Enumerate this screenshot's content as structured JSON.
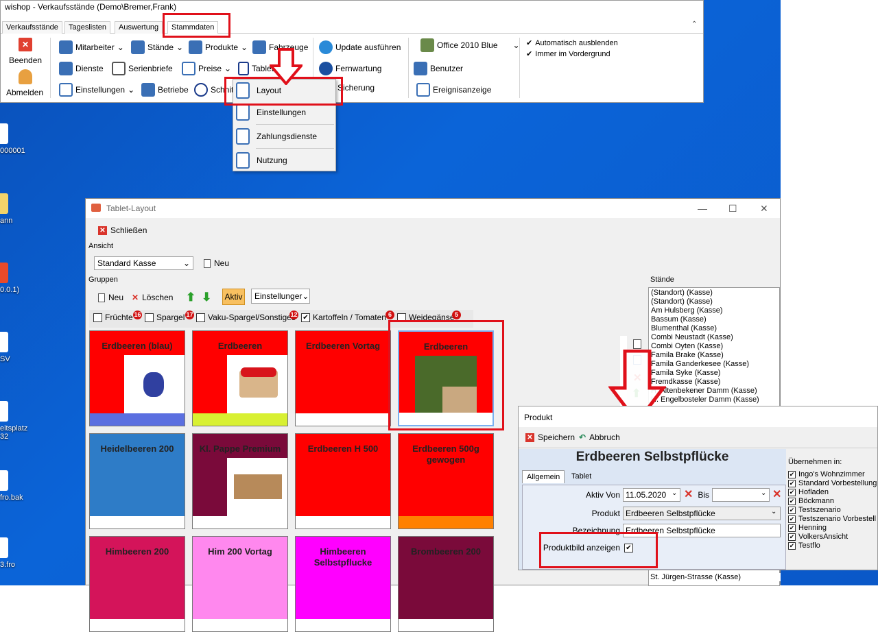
{
  "app": {
    "title": "wishop - Verkaufsstände (Demo\\Bremer,Frank)"
  },
  "tabs": [
    "Verkaufsstände",
    "Tageslisten",
    "Auswertung",
    "Stammdaten"
  ],
  "ribbon": {
    "beenden": "Beenden",
    "abmelden": "Abmelden",
    "mitarbeiter": "Mitarbeiter",
    "dienste": "Dienste",
    "einstellungen": "Einstellungen",
    "staende": "Stände",
    "serienbriefe": "Serienbriefe",
    "betriebe": "Betriebe",
    "produkte": "Produkte",
    "preise": "Preise",
    "schnitt": "Schnit",
    "fahrzeuge": "Fahrzeuge",
    "tablet": "Tablet",
    "update": "Update ausführen",
    "fernwartung": "Fernwartung",
    "sicherung": "Sicherung",
    "theme": "Office 2010 Blue",
    "benutzer": "Benutzer",
    "ereignisanzeige": "Ereignisanzeige",
    "auto_hide": "Automatisch ausblenden",
    "always_top": "Immer im Vordergrund"
  },
  "tablet_menu": [
    "Layout",
    "Einstellungen",
    "Zahlungsdienste",
    "Nutzung"
  ],
  "desktop_icons": [
    "000001",
    "ann",
    "0.0.1)",
    "SV",
    "eitsplatz",
    "32",
    "fro.bak",
    "3.fro"
  ],
  "tablet_layout": {
    "title": "Tablet-Layout",
    "close": "Schließen",
    "ansicht_label": "Ansicht",
    "ansicht_value": "Standard Kasse",
    "neu": "Neu",
    "gruppen_label": "Gruppen",
    "grp_neu": "Neu",
    "grp_loeschen": "Löschen",
    "aktiv": "Aktiv",
    "einstellungen": "Einstellunger",
    "staende_label": "Stände",
    "groups": [
      {
        "name": "Früchte",
        "count": "16",
        "checked": false
      },
      {
        "name": "Spargel",
        "count": "17",
        "checked": false
      },
      {
        "name": "Vaku-Spargel/Sonstiges",
        "count": "12",
        "checked": false
      },
      {
        "name": "Kartoffeln / Tomaten",
        "count": "6",
        "checked": true
      },
      {
        "name": "Weidegänse",
        "count": "5",
        "checked": false
      }
    ],
    "tiles": [
      {
        "name": "Erdbeeren (blau)",
        "bg": "#ff0000",
        "bar": "#5b6fe0",
        "img": "blueberry"
      },
      {
        "name": "Erdbeeren",
        "bg": "#ff0000",
        "bar": "#d8f032",
        "img": "strawbasket"
      },
      {
        "name": "Erdbeeren Vortag",
        "bg": "#ff0000",
        "bar": "#ffffff",
        "img": ""
      },
      {
        "name": "Erdbeeren",
        "bg": "#ff0000",
        "bar": "#ffffff",
        "img": "photo"
      },
      {
        "name": "Heidelbeeren 200",
        "bg": "#2e7cc7",
        "bar": "#ffffff",
        "img": ""
      },
      {
        "name": "Kl. Pappe Premium",
        "bg": "#7a0a3a",
        "bar": "#ffffff",
        "img": "box"
      },
      {
        "name": "Erdbeeren  H 500",
        "bg": "#ff0000",
        "bar": "#ffffff",
        "img": ""
      },
      {
        "name": "Erdbeeren 500g gewogen",
        "bg": "#ff0000",
        "bar": "#ff8000",
        "img": ""
      },
      {
        "name": "Himbeeren 200",
        "bg": "#d4145a",
        "bar": "#ffffff",
        "img": ""
      },
      {
        "name": "Him 200 Vortag",
        "bg": "#ff88ee",
        "bar": "#ffffff",
        "img": ""
      },
      {
        "name": "Himbeeren Selbstpflucke",
        "bg": "#ff00ff",
        "bar": "#ffffff",
        "img": ""
      },
      {
        "name": "Brombeeren 200",
        "bg": "#7a0a3a",
        "bar": "#ffffff",
        "img": ""
      }
    ],
    "staende": [
      "(Standort) (Kasse)",
      "(Standort) (Kasse)",
      "Am Hulsberg  (Kasse)",
      "Bassum  (Kasse)",
      "Blumenthal (Kasse)",
      "Combi Neustadt (Kasse)",
      "Combi Oyten (Kasse)",
      "Famila Brake (Kasse)",
      "Famila Ganderkesee (Kasse)",
      "Famila Syke (Kasse)",
      "Fremdkasse (Kasse)",
      "H. Altenbekener Damm (Kasse)",
      "H. Engelbosteler Damm (Kasse)"
    ],
    "staende_bottom": "St. Jürgen-Strasse (Kasse)"
  },
  "produkt_dialog": {
    "title": "Produkt",
    "speichern": "Speichern",
    "abbruch": "Abbruch",
    "heading": "Erdbeeren Selbstpflücke",
    "tab_allgemein": "Allgemein",
    "tab_tablet": "Tablet",
    "aktiv_von_label": "Aktiv Von",
    "aktiv_von_value": "11.05.2020",
    "bis_label": "Bis",
    "produkt_label": "Produkt",
    "produkt_value": "Erdbeeren Selbstpflücke",
    "bezeichnung_label": "Bezeichnung",
    "bezeichnung_value": "Erdbeeren Selbstpflücke",
    "produktbild_label": "Produktbild anzeigen",
    "uebernehmen_label": "Übernehmen in:",
    "uebernehmen": [
      "Ingo's Wohnzimmer",
      "Standard Vorbestellung",
      "Hofladen",
      "Böckmann",
      "Testszenario",
      "Testszenario Vorbestell",
      "Henning",
      "VolkersAnsicht",
      "Testflo"
    ]
  },
  "colors": {
    "highlight": "#e0101a",
    "desktop": "#0b64d8"
  }
}
